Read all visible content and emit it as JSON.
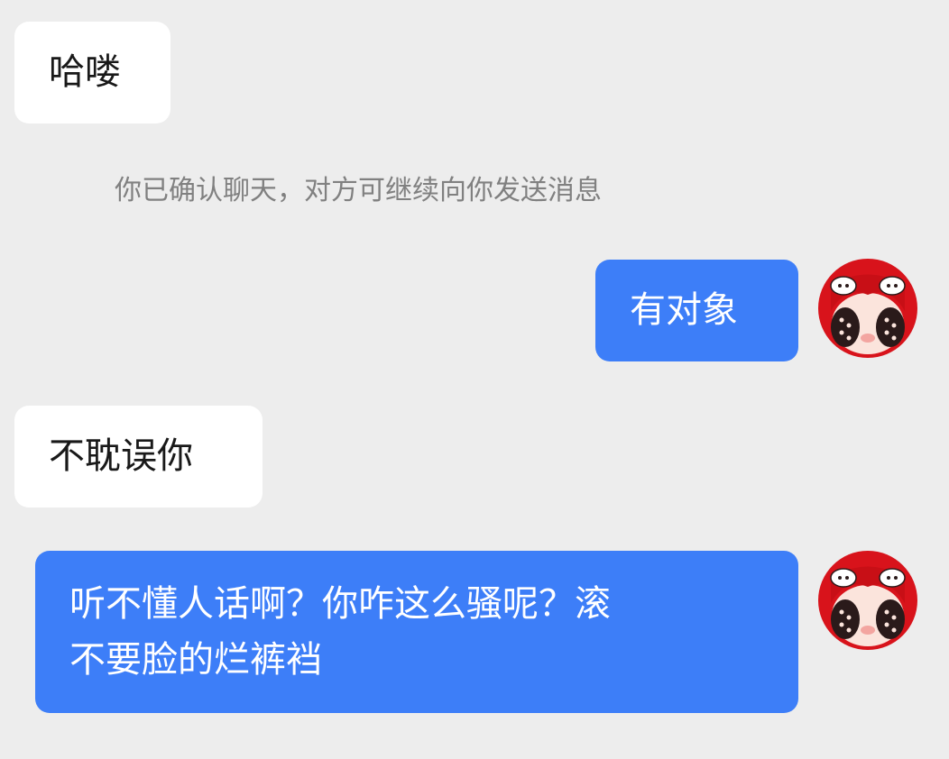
{
  "chat": {
    "messages": [
      {
        "direction": "incoming",
        "text": "哈喽"
      },
      {
        "direction": "system",
        "text": "你已确认聊天，对方可继续向你发送消息"
      },
      {
        "direction": "outgoing",
        "text": "有对象"
      },
      {
        "direction": "incoming",
        "text": "不耽误你"
      },
      {
        "direction": "outgoing",
        "text": "听不懂人话啊？你咋这么骚呢？滚\n不要脸的烂裤裆"
      }
    ]
  },
  "theme": {
    "background": "#ededed",
    "incoming_bubble": "#ffffff",
    "outgoing_bubble": "#3d7ef8",
    "system_text": "#808080"
  },
  "avatar": {
    "icon": "cartoon-girl-avatar-icon",
    "colors": {
      "hair": "#d8131b",
      "face": "#fbe4dc",
      "eyes": "#2a1a1a"
    }
  }
}
